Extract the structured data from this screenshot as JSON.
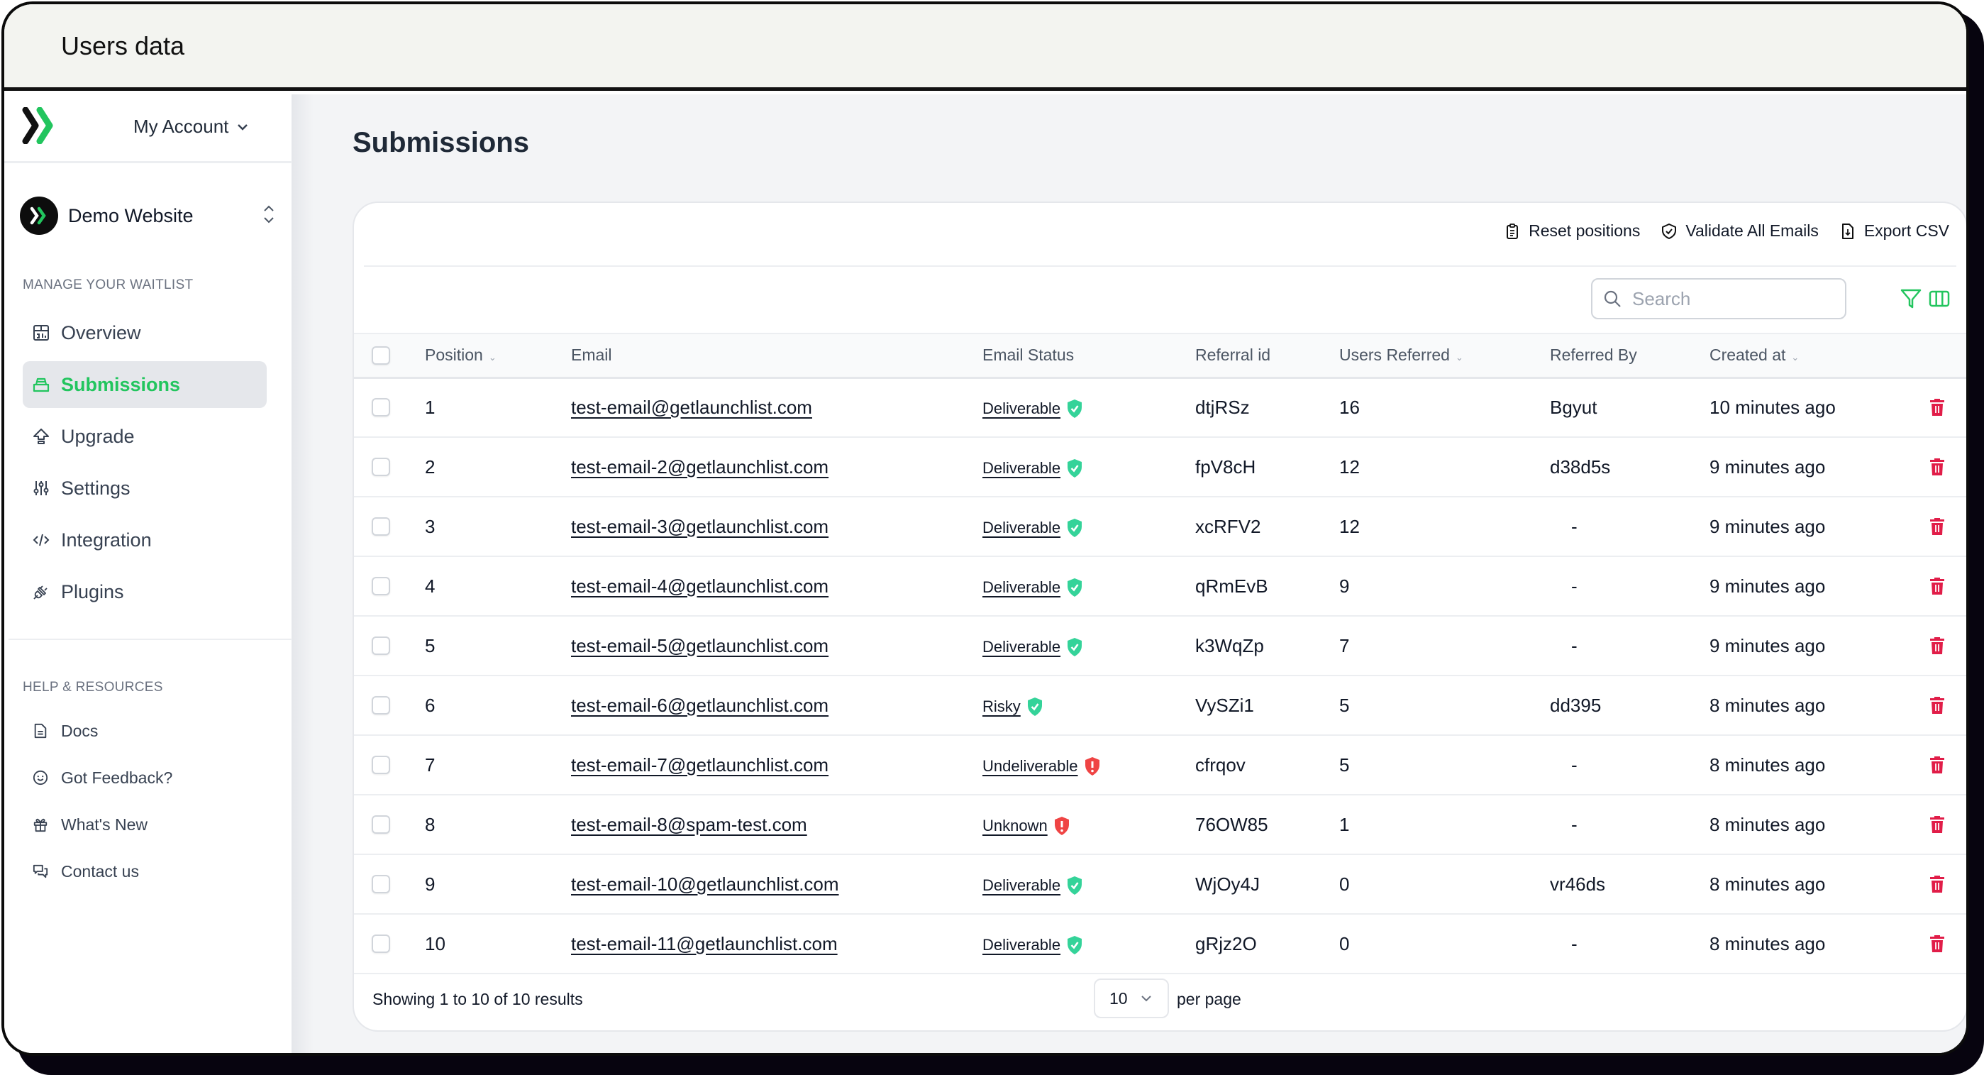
{
  "window": {
    "title": "Users data"
  },
  "sidebar": {
    "account_label": "My Account",
    "website_name": "Demo Website",
    "manage_section_label": "MANAGE YOUR WAITLIST",
    "nav_items": [
      {
        "label": "Overview",
        "icon": "chart-board-icon",
        "active": false
      },
      {
        "label": "Submissions",
        "icon": "inbox-tray-icon",
        "active": true
      },
      {
        "label": "Upgrade",
        "icon": "upgrade-arrow-icon",
        "active": false
      },
      {
        "label": "Settings",
        "icon": "sliders-icon",
        "active": false
      },
      {
        "label": "Integration",
        "icon": "code-icon",
        "active": false
      },
      {
        "label": "Plugins",
        "icon": "plug-icon",
        "active": false
      }
    ],
    "help_section_label": "HELP & RESOURCES",
    "help_items": [
      {
        "label": "Docs",
        "icon": "document-icon"
      },
      {
        "label": "Got Feedback?",
        "icon": "smiley-icon"
      },
      {
        "label": "What's New",
        "icon": "gift-icon"
      },
      {
        "label": "Contact us",
        "icon": "chat-bubbles-icon"
      }
    ]
  },
  "main": {
    "page_title": "Submissions",
    "toolbar": {
      "reset_label": "Reset positions",
      "validate_label": "Validate All Emails",
      "export_label": "Export CSV"
    },
    "search": {
      "placeholder": "Search",
      "value": ""
    },
    "table": {
      "columns": [
        "Position",
        "Email",
        "Email Status",
        "Referral id",
        "Users Referred",
        "Referred By",
        "Created at"
      ],
      "sortable_columns": [
        "Position",
        "Users Referred",
        "Created at"
      ],
      "rows": [
        {
          "position": "1",
          "email": "test-email@getlaunchlist.com",
          "status": "Deliverable",
          "status_kind": "ok",
          "referral_id": "dtjRSz",
          "users_referred": "16",
          "referred_by": "Bgyut",
          "created_at": "10 minutes ago"
        },
        {
          "position": "2",
          "email": "test-email-2@getlaunchlist.com",
          "status": "Deliverable",
          "status_kind": "ok",
          "referral_id": "fpV8cH",
          "users_referred": "12",
          "referred_by": "d38d5s",
          "created_at": "9 minutes ago"
        },
        {
          "position": "3",
          "email": "test-email-3@getlaunchlist.com",
          "status": "Deliverable",
          "status_kind": "ok",
          "referral_id": "xcRFV2",
          "users_referred": "12",
          "referred_by": "-",
          "created_at": "9 minutes ago"
        },
        {
          "position": "4",
          "email": "test-email-4@getlaunchlist.com",
          "status": "Deliverable",
          "status_kind": "ok",
          "referral_id": "qRmEvB",
          "users_referred": "9",
          "referred_by": "-",
          "created_at": "9 minutes ago"
        },
        {
          "position": "5",
          "email": "test-email-5@getlaunchlist.com",
          "status": "Deliverable",
          "status_kind": "ok",
          "referral_id": "k3WqZp",
          "users_referred": "7",
          "referred_by": "-",
          "created_at": "9 minutes ago"
        },
        {
          "position": "6",
          "email": "test-email-6@getlaunchlist.com",
          "status": "Risky",
          "status_kind": "ok",
          "referral_id": "VySZi1",
          "users_referred": "5",
          "referred_by": "dd395",
          "created_at": "8 minutes ago"
        },
        {
          "position": "7",
          "email": "test-email-7@getlaunchlist.com",
          "status": "Undeliverable",
          "status_kind": "bad",
          "referral_id": "cfrqov",
          "users_referred": "5",
          "referred_by": "-",
          "created_at": "8 minutes ago"
        },
        {
          "position": "8",
          "email": "test-email-8@spam-test.com",
          "status": "Unknown",
          "status_kind": "bad",
          "referral_id": "76OW85",
          "users_referred": "1",
          "referred_by": "-",
          "created_at": "8 minutes ago"
        },
        {
          "position": "9",
          "email": "test-email-10@getlaunchlist.com",
          "status": "Deliverable",
          "status_kind": "ok",
          "referral_id": "WjOy4J",
          "users_referred": "0",
          "referred_by": "vr46ds",
          "created_at": "8 minutes ago"
        },
        {
          "position": "10",
          "email": "test-email-11@getlaunchlist.com",
          "status": "Deliverable",
          "status_kind": "ok",
          "referral_id": "gRjz2O",
          "users_referred": "0",
          "referred_by": "-",
          "created_at": "8 minutes ago"
        }
      ]
    },
    "footer": {
      "showing_text": "Showing 1 to 10 of 10 results",
      "per_page_value": "10",
      "per_page_label": "per page"
    }
  },
  "colors": {
    "accent_green": "#22c55e",
    "status_ok": "#34d399",
    "status_bad": "#ef4444",
    "delete_red": "#e11d48"
  }
}
